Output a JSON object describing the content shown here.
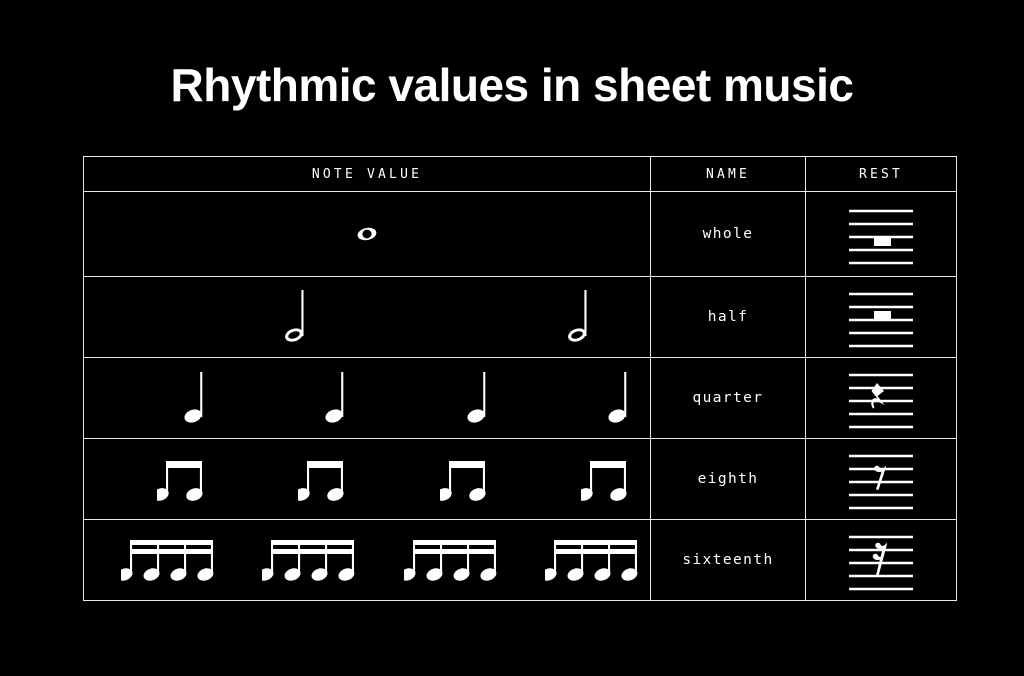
{
  "page": {
    "title": "Rhythmic values in sheet music",
    "background_color": "#000000",
    "foreground_color": "#ffffff"
  },
  "table": {
    "headers": [
      {
        "label": "NOTE VALUE",
        "name": "note-value"
      },
      {
        "label": "NAME",
        "name": "name"
      },
      {
        "label": "REST",
        "name": "rest"
      }
    ],
    "rows": [
      {
        "name": "whole",
        "note_glyph": "whole-note",
        "rest_glyph": "whole-rest",
        "note_count": 1,
        "notes_per_group": 1,
        "beams": 0
      },
      {
        "name": "half",
        "note_glyph": "half-note",
        "rest_glyph": "half-rest",
        "note_count": 2,
        "notes_per_group": 1,
        "beams": 0
      },
      {
        "name": "quarter",
        "note_glyph": "quarter-note",
        "rest_glyph": "quarter-rest",
        "note_count": 4,
        "notes_per_group": 1,
        "beams": 0
      },
      {
        "name": "eighth",
        "note_glyph": "eighth-note",
        "rest_glyph": "eighth-rest",
        "note_count": 8,
        "notes_per_group": 2,
        "beams": 1
      },
      {
        "name": "sixteenth",
        "note_glyph": "sixteenth-note",
        "rest_glyph": "sixteenth-rest",
        "note_count": 16,
        "notes_per_group": 4,
        "beams": 2
      }
    ]
  }
}
